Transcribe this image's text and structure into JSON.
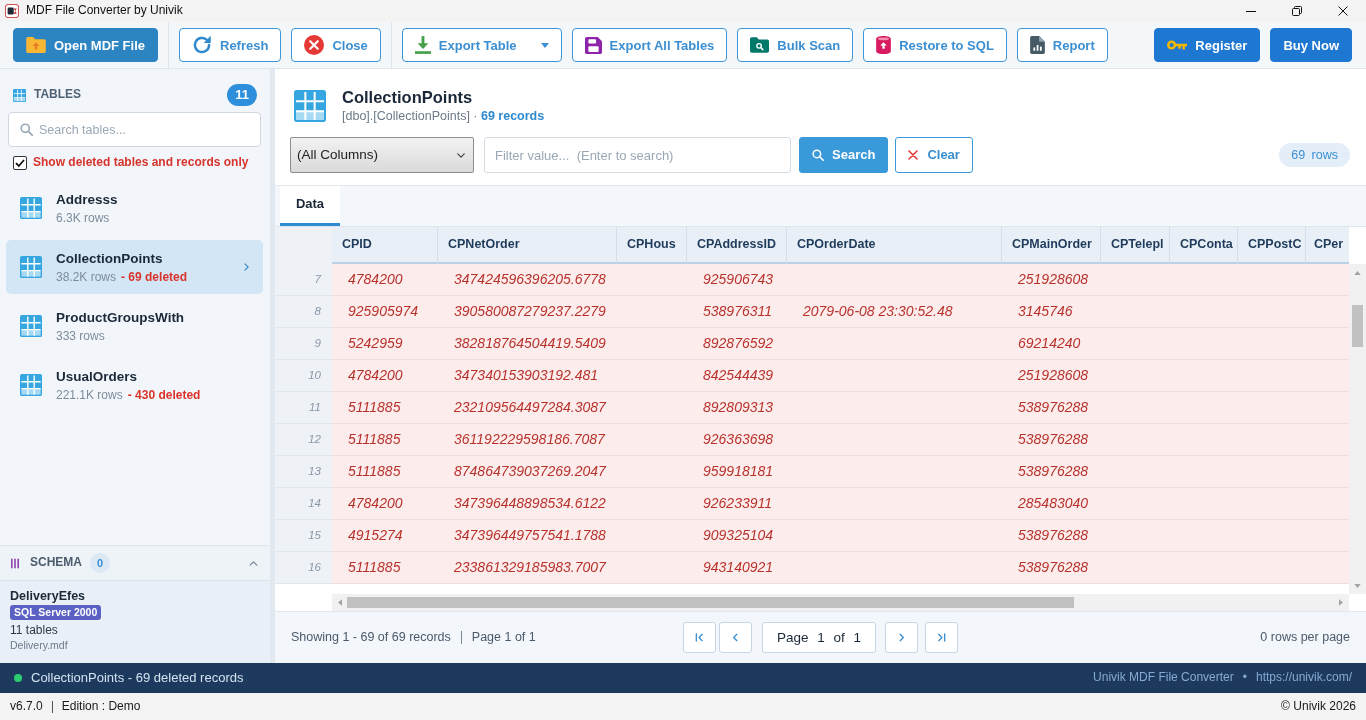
{
  "window": {
    "title": "MDF File Converter by Univik"
  },
  "toolbar": {
    "groups": [
      [
        {
          "label": "Open MDF File",
          "kind": "primary"
        }
      ],
      [
        {
          "label": "Refresh",
          "kind": "outline"
        },
        {
          "label": "Close",
          "kind": "outline"
        }
      ],
      [
        {
          "label": "Export Table",
          "kind": "outline",
          "dropdown": true
        },
        {
          "label": "Export All Tables",
          "kind": "outline"
        },
        {
          "label": "Bulk Scan",
          "kind": "outline"
        },
        {
          "label": "Restore to SQL",
          "kind": "outline"
        },
        {
          "label": "Report",
          "kind": "outline"
        }
      ]
    ],
    "right": [
      {
        "label": "Register",
        "kind": "cta"
      },
      {
        "label": "Buy Now",
        "kind": "cta"
      }
    ]
  },
  "sidebar": {
    "tables_label": "TABLES",
    "tables_count": "11",
    "search": {
      "placeholder": "Search tables..."
    },
    "show_deleted": {
      "label": "Show deleted tables and records only",
      "checked": true
    },
    "tables": [
      {
        "name": "Addresss",
        "rows": "6.3K rows",
        "selected": false
      },
      {
        "name": "CollectionPoints",
        "rows": "38.2K rows",
        "deleted": "- 69 deleted",
        "selected": true
      },
      {
        "name": "ProductGroupsWith",
        "rows": "333 rows",
        "selected": false
      },
      {
        "name": "UsualOrders",
        "rows": "221.1K rows",
        "deleted": "- 430 deleted",
        "selected": false
      }
    ],
    "schema": {
      "label": "SCHEMA",
      "count": "0",
      "expanded": true,
      "database": "DeliveryEfes",
      "server": "SQL Server 2000",
      "tables": "11 tables",
      "file": "Delivery.mdf"
    }
  },
  "main": {
    "title": "CollectionPoints",
    "subtitle": "[dbo].[CollectionPoints] · **69 records**"
  },
  "filter": {
    "column": "(All Columns)",
    "placeholder": "Filter value...  (Enter to search)",
    "search_button": "Search",
    "clear_button": "Clear",
    "row_count": "69 rows"
  },
  "tabs": [
    {
      "label": "Data",
      "selected": true
    }
  ],
  "table": {
    "columns": [
      "CPID",
      "CPNetOrder",
      "CPHous",
      "CPAddressID",
      "CPOrderDate",
      "CPMainOrder",
      "CPTelepl",
      "CPConta",
      "CPPostC",
      "CPer"
    ],
    "rows": [
      {
        "number": "7",
        "deleted": true,
        "cells": [
          "4784200",
          "347424596396205.6778",
          null,
          "925906743",
          null,
          "251928608"
        ]
      },
      {
        "number": "8",
        "deleted": true,
        "cells": [
          "925905974",
          "390580087279237.2279",
          null,
          "538976311",
          "2079-06-08 23:30:52.48",
          "3145746"
        ]
      },
      {
        "number": "9",
        "deleted": true,
        "cells": [
          "5242959",
          "382818764504419.5409",
          null,
          "892876592",
          null,
          "69214240"
        ]
      },
      {
        "number": "10",
        "deleted": true,
        "cells": [
          "4784200",
          "347340153903192.481",
          null,
          "842544439",
          null,
          "251928608"
        ]
      },
      {
        "number": "11",
        "deleted": true,
        "cells": [
          "5111885",
          "232109564497284.3087",
          null,
          "892809313",
          null,
          "538976288"
        ]
      },
      {
        "number": "12",
        "deleted": true,
        "cells": [
          "5111885",
          "361192229598186.7087",
          null,
          "926363698",
          null,
          "538976288"
        ]
      },
      {
        "number": "13",
        "deleted": true,
        "cells": [
          "5111885",
          "874864739037269.2047",
          null,
          "959918181",
          null,
          "538976288"
        ]
      },
      {
        "number": "14",
        "deleted": true,
        "cells": [
          "4784200",
          "347396448898534.6122",
          null,
          "926233911",
          null,
          "285483040"
        ]
      },
      {
        "number": "15",
        "deleted": true,
        "cells": [
          "4915274",
          "347396449757541.1788",
          null,
          "909325104",
          null,
          "538976288"
        ]
      },
      {
        "number": "16",
        "deleted": true,
        "cells": [
          "5111885",
          "233861329185983.7007",
          null,
          "943140921",
          null,
          "538976288"
        ]
      }
    ]
  },
  "pager": {
    "summary": "Showing 1 - 69 of 69 records",
    "page_info": "Page 1 of 1",
    "page_box": "Page 1 of 1",
    "per_page": "0 rows per page"
  },
  "status_bar": {
    "message": "CollectionPoints - 69 deleted records",
    "product": "Univik MDF File Converter",
    "separator": "•",
    "url": "https://univik.com/"
  },
  "footer": {
    "version": "v6.7.0",
    "edition": "Edition : Demo",
    "copyright": "© Univik 2026"
  }
}
